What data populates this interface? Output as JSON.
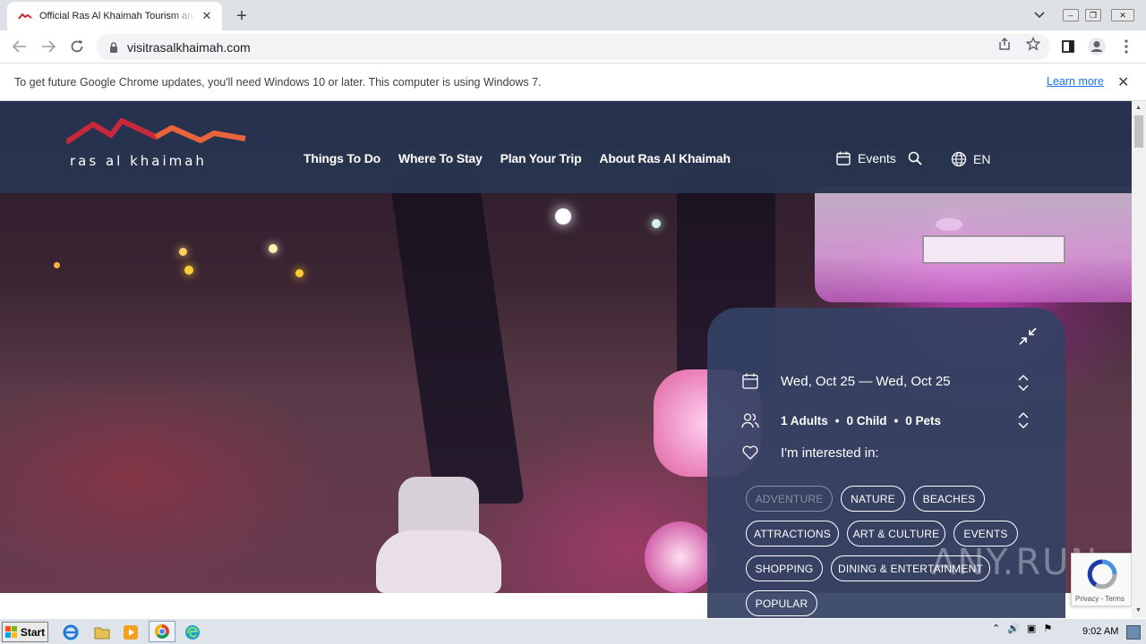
{
  "browser": {
    "tab_title": "Official Ras Al Khaimah Tourism and V",
    "url": "visitrasalkhaimah.com"
  },
  "infobar": {
    "message": "To get future Google Chrome updates, you'll need Windows 10 or later. This computer is using Windows 7.",
    "learn_more": "Learn more"
  },
  "header": {
    "logo_text": "ras al khaimah",
    "nav": [
      "Things To Do",
      "Where To Stay",
      "Plan Your Trip",
      "About Ras Al Khaimah"
    ],
    "events_label": "Events",
    "language": "EN"
  },
  "planner": {
    "dates": "Wed, Oct 25 — Wed, Oct 25",
    "guests": {
      "adults": "1 Adults",
      "children": "0 Child",
      "pets": "0 Pets",
      "separator": "•"
    },
    "interested_label": "I'm interested in:",
    "tags": [
      "ADVENTURE",
      "NATURE",
      "BEACHES",
      "ATTRACTIONS",
      "ART & CULTURE",
      "EVENTS",
      "SHOPPING",
      "DINING & ENTERTAINMENT",
      "POPULAR"
    ]
  },
  "recaptcha": {
    "terms": "Privacy - Terms"
  },
  "watermark": "ANY.RUN",
  "taskbar": {
    "start": "Start",
    "clock": "9:02 AM"
  },
  "colors": {
    "header_bg": "#283450",
    "panel_bg": "#344264",
    "logo_red": "#c8283c",
    "logo_orange": "#e8643c",
    "link_blue": "#1a73e8"
  }
}
